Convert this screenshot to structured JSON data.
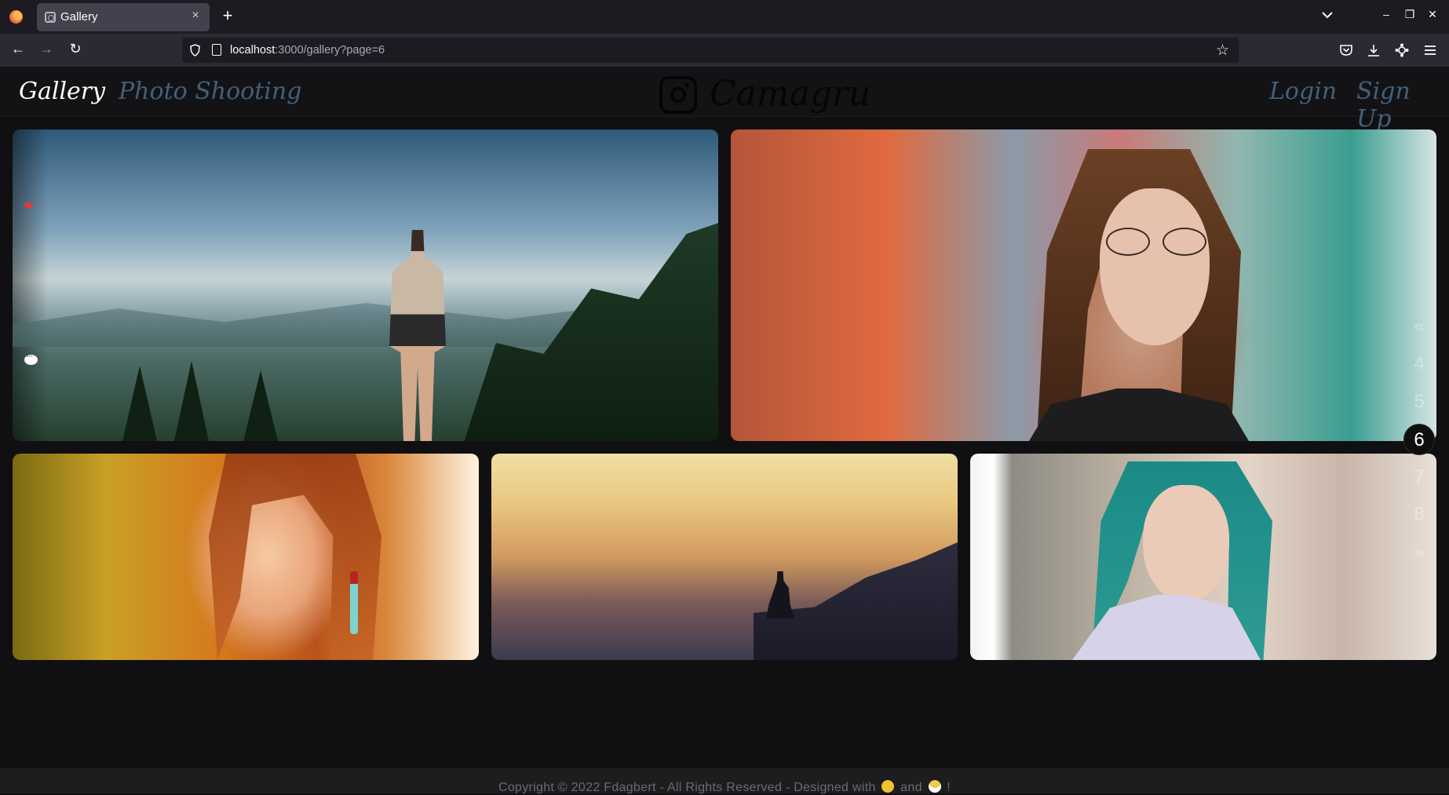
{
  "browser": {
    "tab_title": "Gallery",
    "tab_close": "×",
    "new_tab": "+",
    "url_host": "localhost",
    "url_path": ":3000/gallery?page=6",
    "nav": {
      "back": "←",
      "forward": "→",
      "reload": "↻"
    },
    "window": {
      "minimize": "–",
      "restore": "❐",
      "close": "✕"
    },
    "star": "☆"
  },
  "header": {
    "nav_gallery": "Gallery",
    "nav_photo_shooting": "Photo Shooting",
    "brand_name": "Camagru",
    "nav_login": "Login",
    "nav_signup": "Sign Up"
  },
  "gallery": {
    "photos": [
      {
        "subject": "hiker-on-mountain",
        "like_icon": "❤",
        "comment_icon": "comment-bubble"
      },
      {
        "subject": "woman-with-glasses"
      },
      {
        "subject": "woman-with-red-hair"
      },
      {
        "subject": "man-sitting-on-cliff-at-sunset"
      },
      {
        "subject": "woman-with-teal-hair"
      }
    ]
  },
  "pagination": {
    "prev": "«",
    "pages": [
      "4",
      "5",
      "6",
      "7",
      "8"
    ],
    "current": "6",
    "next": "»"
  },
  "footer": {
    "text_before": "Copyright © 2022 Fdagbert - All Rights Reserved - Designed with",
    "text_and": "and",
    "text_end": "!",
    "emoji_1": "flexed-biceps",
    "emoji_2": "face-with-mask"
  },
  "colors": {
    "nav_link_dim": "#43607b",
    "page_bg": "#101012",
    "footer_text": "#6b6b70"
  }
}
